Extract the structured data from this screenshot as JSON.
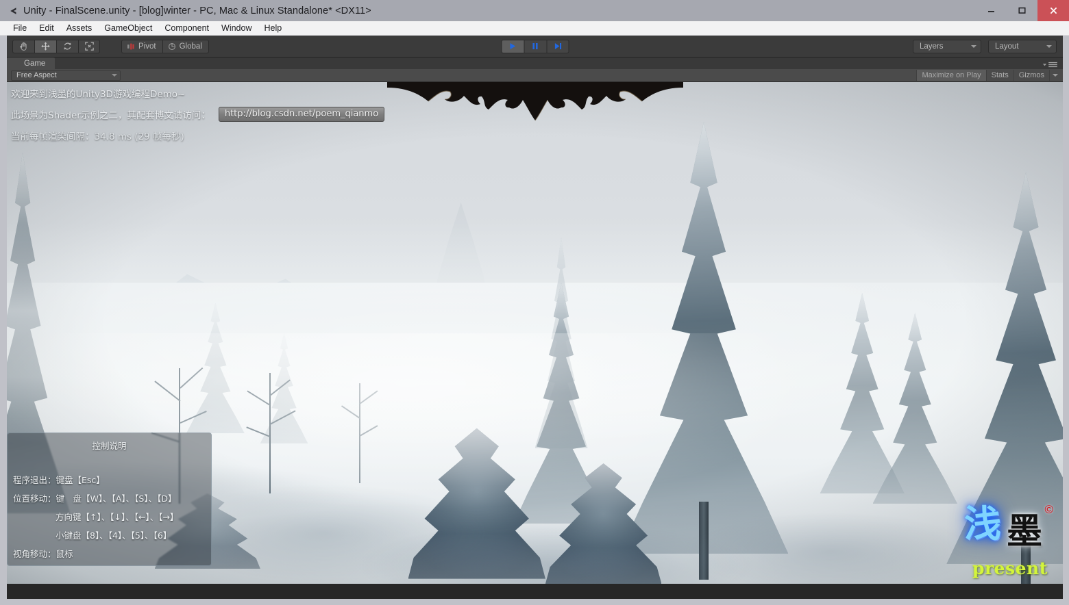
{
  "window": {
    "title": "Unity - FinalScene.unity - [blog]winter - PC, Mac & Linux Standalone* <DX11>",
    "logo_icon": "unity-logo-icon",
    "controls": {
      "minimize": "minimize-icon",
      "maximize": "maximize-icon",
      "close": "close-icon"
    },
    "close_color": "#cb5157"
  },
  "menu": {
    "items": [
      {
        "label": "File"
      },
      {
        "label": "Edit"
      },
      {
        "label": "Assets"
      },
      {
        "label": "GameObject"
      },
      {
        "label": "Component"
      },
      {
        "label": "Window"
      },
      {
        "label": "Help"
      }
    ]
  },
  "toolbar": {
    "tools": [
      {
        "name": "hand-tool",
        "icon": "hand-icon",
        "active": false
      },
      {
        "name": "move-tool",
        "icon": "move-icon",
        "active": true
      },
      {
        "name": "rotate-tool",
        "icon": "rotate-icon",
        "active": false
      },
      {
        "name": "scale-tool",
        "icon": "scale-icon",
        "active": false
      }
    ],
    "pivot_label": "Pivot",
    "pivot_icon": "pivot-icon",
    "global_label": "Global",
    "global_icon": "global-icon",
    "playback": [
      {
        "name": "play-button",
        "icon": "play-icon",
        "engaged": true
      },
      {
        "name": "pause-button",
        "icon": "pause-icon",
        "engaged": false
      },
      {
        "name": "step-button",
        "icon": "step-icon",
        "engaged": false
      }
    ],
    "playback_accent": "#2268e0",
    "layers_label": "Layers",
    "layout_label": "Layout"
  },
  "game_view": {
    "tab_label": "Game",
    "tab_icon": "game-view-icon",
    "panel_menu_icon": "panel-menu-icon",
    "aspect_value": "Free Aspect",
    "maximize_on_play_label": "Maximize on Play",
    "stats_label": "Stats",
    "gizmos_label": "Gizmos"
  },
  "hud": {
    "welcome_line": "欢迎来到浅墨的Unity3D游戏编程Demo~",
    "shader_line": "此场景为Shader示例之二，其配套博文请访问：",
    "url_button": "http://blog.csdn.net/poem_qianmo",
    "fps_line": "当前每帧渲染间隔：34.8 ms (29 帧每秒)"
  },
  "controls_box": {
    "title": "控制说明",
    "lines": [
      {
        "text": "程序退出：键盘【Esc】",
        "indent": false
      },
      {
        "text": "位置移动：键　盘【W】、【A】、【S】、【D】",
        "indent": false
      },
      {
        "text": "方向键【↑】、【↓】、【←】、【→】",
        "indent": true
      },
      {
        "text": "小键盘【8】、【4】、【5】、【6】",
        "indent": true
      },
      {
        "text": "视角移动：鼠标",
        "indent": false
      }
    ]
  },
  "watermark": {
    "char_one": "浅",
    "char_two": "墨",
    "copyright": "©",
    "present": "present",
    "glow_color": "#7fd4ff",
    "present_color": "#d4f53a",
    "copyright_color": "#d4202a"
  },
  "scene": {
    "description": "winter-snow-forest-scene",
    "sky_color": "#dfe3e6",
    "snow_color": "#f2f5f6",
    "conifer_color": "#3b5260"
  }
}
